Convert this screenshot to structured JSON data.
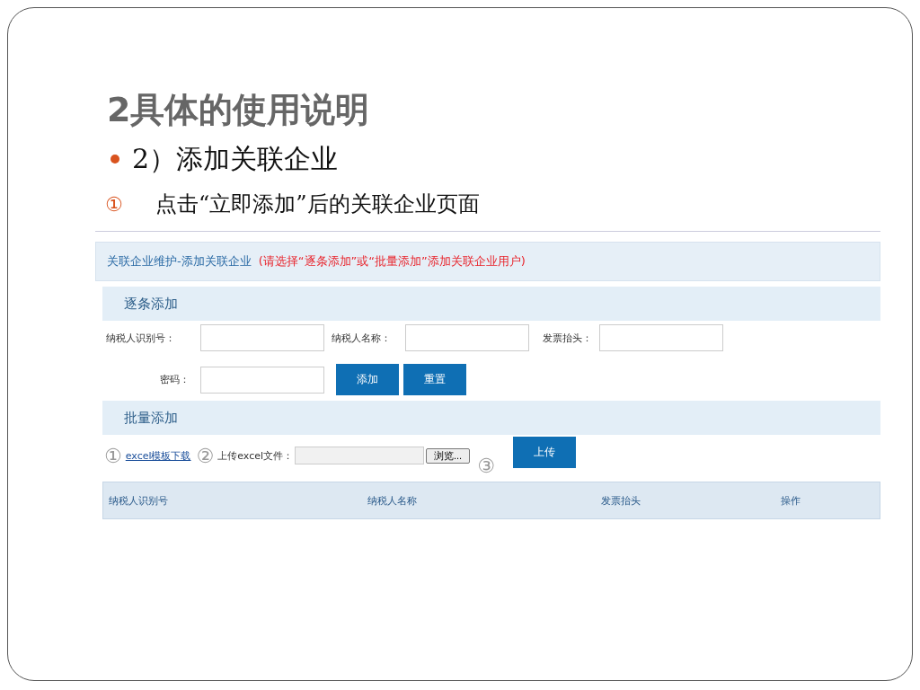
{
  "slide": {
    "title": "2具体的使用说明",
    "bullet": "2）添加关联企业",
    "step": {
      "marker": "①",
      "text": "点击“立即添加”后的关联企业页面"
    }
  },
  "page": {
    "breadcrumb": "关联企业维护-添加关联企业",
    "hint": "(请选择“逐条添加”或“批量添加”添加关联企业用户)",
    "single": {
      "title": "逐条添加",
      "fields": [
        {
          "label": "纳税人识别号："
        },
        {
          "label": "纳税人名称："
        },
        {
          "label": "发票抬头："
        },
        {
          "label": "密码："
        }
      ],
      "buttons": [
        "添加",
        "重置"
      ]
    },
    "batch": {
      "title": "批量添加",
      "marks": [
        "①",
        "②",
        "③"
      ],
      "template_link": "excel模板下载",
      "upload_label": "上传excel文件：",
      "browse_button": "浏览...",
      "upload_button": "上传"
    },
    "table": {
      "columns": [
        "纳税人识别号",
        "纳税人名称",
        "发票抬头",
        "操作"
      ]
    }
  }
}
